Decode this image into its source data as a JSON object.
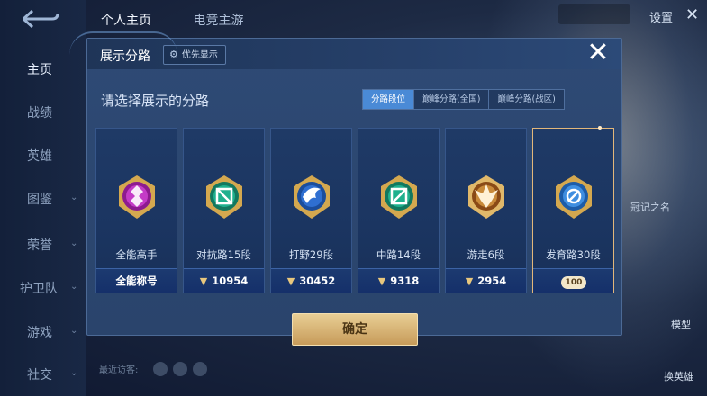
{
  "sidebar": {
    "items": [
      {
        "label": "主页"
      },
      {
        "label": "战绩"
      },
      {
        "label": "英雄"
      },
      {
        "label": "图鉴"
      },
      {
        "label": "荣誉"
      },
      {
        "label": "护卫队"
      },
      {
        "label": "游戏"
      },
      {
        "label": "社交"
      }
    ]
  },
  "top_tabs": [
    "个人主页",
    "电竞主游"
  ],
  "header_right": {
    "settings": "设置"
  },
  "background": {
    "side_text": "冠记之名",
    "model_label": "模型",
    "switch_hero": "换英雄",
    "recent_visitors": "最近访客:"
  },
  "modal": {
    "title": "展示分路",
    "priority_label": "优先显示",
    "subtitle": "请选择展示的分路",
    "tabs": [
      {
        "label": "分路段位",
        "active": true
      },
      {
        "label": "巅峰分路(全国)",
        "active": false
      },
      {
        "label": "巅峰分路(战区)",
        "active": false
      }
    ],
    "cards": [
      {
        "label": "全能高手",
        "footer": "全能称号",
        "points": null,
        "badge_color": "#b12db0"
      },
      {
        "label": "对抗路15段",
        "footer": "10954",
        "points": true,
        "badge_color": "#1fa68a"
      },
      {
        "label": "打野29段",
        "footer": "30452",
        "points": true,
        "badge_color": "#2f6fd1"
      },
      {
        "label": "中路14段",
        "footer": "9318",
        "points": true,
        "badge_color": "#1fa68a"
      },
      {
        "label": "游走6段",
        "footer": "2954",
        "points": true,
        "badge_color": "#c98a3a"
      },
      {
        "label": "发育路30段",
        "footer": "100",
        "points": null,
        "badge_color": "#3f8ee0",
        "selected": true
      }
    ],
    "confirm_label": "确定"
  },
  "colors": {
    "accent": "#4a8ad6",
    "gold": "#e2b77a",
    "modal_bg": "#2e4a75"
  }
}
